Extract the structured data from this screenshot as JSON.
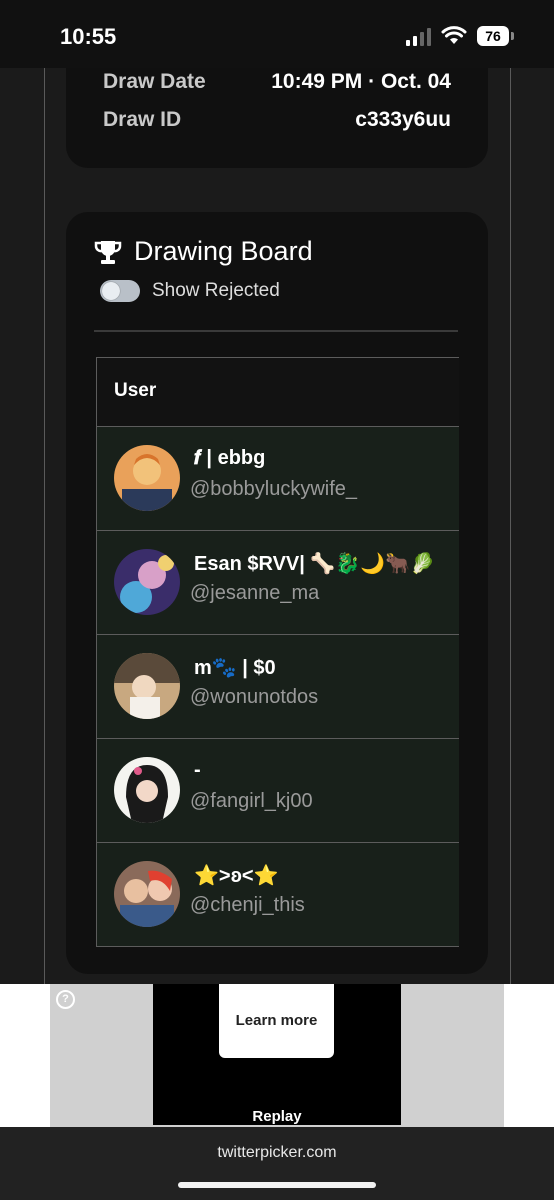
{
  "status_bar": {
    "time": "10:55",
    "battery": "76"
  },
  "draw_info": {
    "date_label": "Draw Date",
    "date_value": "10:49 PM · Oct. 04",
    "id_label": "Draw ID",
    "id_value": "c333y6uu"
  },
  "board": {
    "title": "Drawing Board",
    "toggle_label": "Show Rejected",
    "toggle_on": false,
    "column_header": "User",
    "rows": [
      {
        "name": "𝒇 | ebbg",
        "handle": "@bobbyluckywife_"
      },
      {
        "name": "Esan $RVV| 🦴🐉🌙🐂🥬",
        "handle": "@jesanne_ma"
      },
      {
        "name": "m🐾 | $0",
        "handle": "@wonunotdos"
      },
      {
        "name": "-",
        "handle": "@fangirl_kj00"
      },
      {
        "name": "⭐>ʚ<⭐",
        "handle": "@chenji_this"
      }
    ]
  },
  "ad": {
    "help_glyph": "?",
    "learn_more": "Learn more",
    "replay": "Replay"
  },
  "browser": {
    "url": "twitterpicker.com"
  }
}
